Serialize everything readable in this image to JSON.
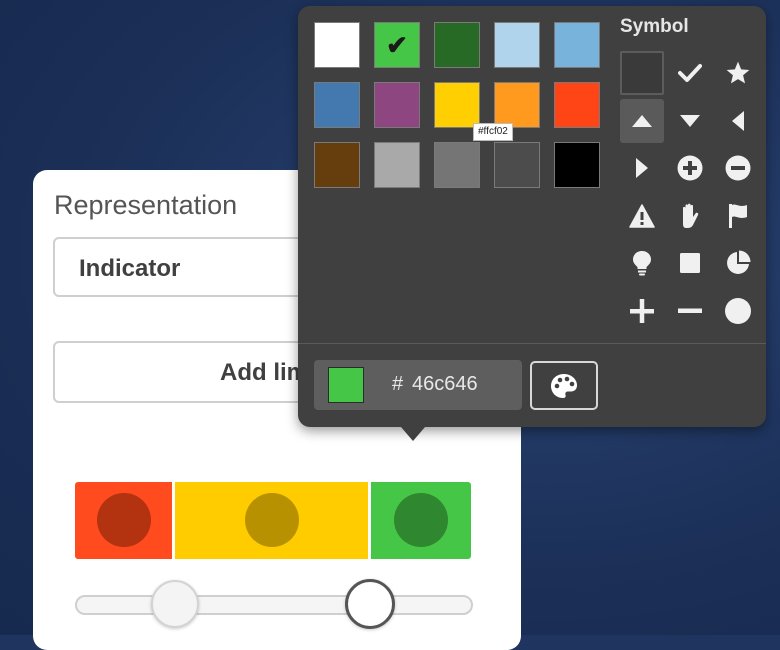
{
  "representation": {
    "label": "Representation",
    "selected": "Indicator",
    "add_button_label": "Add limit"
  },
  "range_bar": {
    "segments": [
      {
        "color": "#ff4b1e",
        "dot_color": "#b3320f"
      },
      {
        "color": "#ffcc00",
        "dot_color": "#b89100"
      },
      {
        "color": "#46c646",
        "dot_color": "#2f872f"
      }
    ],
    "limits": [
      0.25,
      0.75
    ]
  },
  "color_picker": {
    "swatches": [
      {
        "color": "#ffffff",
        "selected": false
      },
      {
        "color": "#46c646",
        "selected": true
      },
      {
        "color": "#276a26",
        "selected": false
      },
      {
        "color": "#b0d4ec",
        "selected": false
      },
      {
        "color": "#78b3dc",
        "selected": false
      },
      {
        "color": "#4479b0",
        "selected": false
      },
      {
        "color": "#8e4680",
        "selected": false
      },
      {
        "color": "#ffcf02",
        "selected": false
      },
      {
        "color": "#ff9a1e",
        "selected": false
      },
      {
        "color": "#ff4416",
        "selected": false
      },
      {
        "color": "#663d0c",
        "selected": false
      },
      {
        "color": "#a9a9a9",
        "selected": false
      },
      {
        "color": "#757575",
        "selected": false
      },
      {
        "color": "#4c4c4c",
        "selected": false
      },
      {
        "color": "#000000",
        "selected": false
      }
    ],
    "hover_tooltip": "#ffcf02",
    "hex_hash": "#",
    "hex_value": "46c646",
    "preview_color": "#46c646"
  },
  "symbols": {
    "title": "Symbol",
    "items": [
      "none",
      "check-icon",
      "star-icon",
      "triangle-up-icon",
      "triangle-down-icon",
      "triangle-left-icon",
      "triangle-right-icon",
      "plus-circle-icon",
      "minus-circle-icon",
      "warning-icon",
      "hand-icon",
      "flag-icon",
      "lightbulb-icon",
      "square-icon",
      "pie-icon",
      "plus-icon",
      "minus-icon",
      "circle-icon"
    ],
    "selected": "triangle-up-icon"
  }
}
